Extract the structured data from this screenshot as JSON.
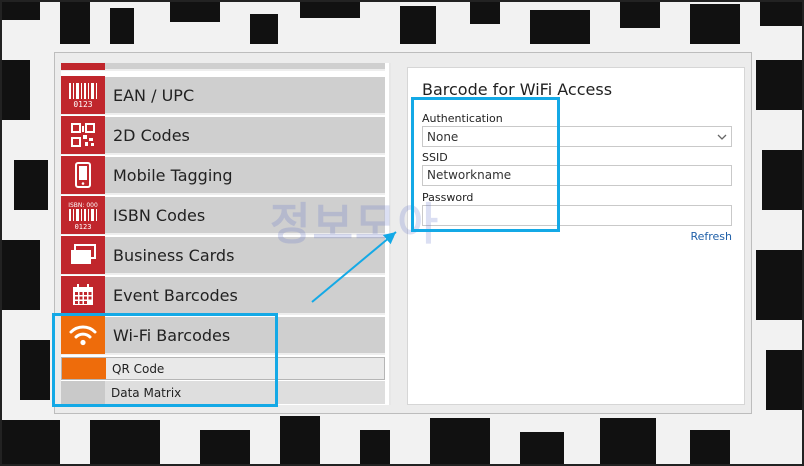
{
  "menu": {
    "items": [
      {
        "label": "EAN / UPC",
        "icon": "barcode-icon"
      },
      {
        "label": "2D Codes",
        "icon": "qr-code-icon"
      },
      {
        "label": "Mobile Tagging",
        "icon": "mobile-phone-icon"
      },
      {
        "label": "ISBN Codes",
        "icon": "isbn-barcode-icon"
      },
      {
        "label": "Business Cards",
        "icon": "business-cards-icon"
      },
      {
        "label": "Event Barcodes",
        "icon": "calendar-icon"
      },
      {
        "label": "Wi-Fi Barcodes",
        "icon": "wifi-icon"
      }
    ],
    "sub_items": [
      {
        "label": "QR Code"
      },
      {
        "label": "Data Matrix"
      }
    ],
    "icon_text": {
      "ean": "0123",
      "isbn_top": "ISBN: 000",
      "isbn_bottom": "0123"
    }
  },
  "form": {
    "title": "Barcode for WiFi Access",
    "authentication_label": "Authentication",
    "authentication_value": "None",
    "ssid_label": "SSID",
    "ssid_value": "Networkname",
    "password_label": "Password",
    "password_value": "",
    "refresh_label": "Refresh"
  },
  "watermark": "정보모아",
  "colors": {
    "menu_red": "#c0262c",
    "menu_orange": "#ee6c0b",
    "menu_gray": "#cfcfcf",
    "highlight_blue": "#14a9e6",
    "link_blue": "#1f5fa8"
  }
}
